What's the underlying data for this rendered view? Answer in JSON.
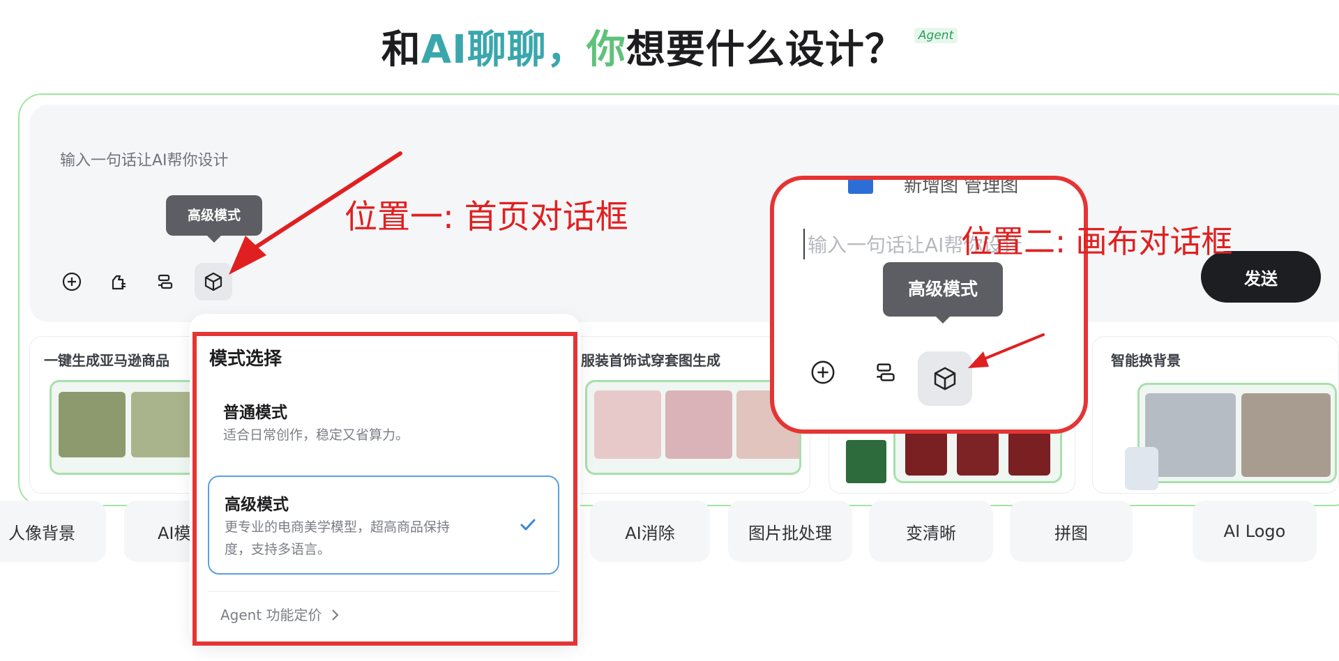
{
  "header": {
    "title_parts": [
      "和",
      "AI聊聊，",
      "你",
      "想要什么设计？"
    ],
    "agent_badge": "Agent"
  },
  "home_dialog": {
    "input_placeholder": "输入一句话让AI帮你设计",
    "tooltip": "高级模式",
    "toolbar_icons": [
      "plus-circle-icon",
      "bag-icon",
      "layout-icon",
      "cube-icon"
    ]
  },
  "cards": [
    {
      "title": "一键生成亚马逊商品"
    },
    {
      "title": "服装首饰试穿套图生成"
    },
    {
      "title": ""
    },
    {
      "title": "智能换背景"
    }
  ],
  "shortcuts": [
    "人像背景",
    "AI模",
    "AI消除",
    "图片批处理",
    "变清晰",
    "拼图",
    "AI Logo"
  ],
  "mode_dropdown": {
    "title": "模式选择",
    "modes": [
      {
        "name": "普通模式",
        "desc": "适合日常创作，稳定又省算力。",
        "selected": false
      },
      {
        "name": "高级模式",
        "desc_line1": "更专业的电商美学模型，超高商品保持",
        "desc_line2": "度，支持多语言。",
        "selected": true
      }
    ],
    "pricing_link": "Agent 功能定价"
  },
  "canvas_dialog": {
    "input_placeholder": "输入一句话让AI帮你设计",
    "partial_top_text": "新增图  管理图",
    "tooltip": "高级模式",
    "send_button": "发送",
    "toolbar_icons": [
      "plus-circle-icon",
      "layout-icon",
      "cube-icon"
    ]
  },
  "annotations": {
    "position_one": "位置一: 首页对话框",
    "position_two": "位置二: 画布对话框"
  },
  "colors": {
    "annotation_red": "#e53434",
    "accent_teal": "#3aa7ad",
    "accent_green": "#5fc27a",
    "selected_border": "#5a9fe0",
    "send_bg": "#1c1e22"
  }
}
